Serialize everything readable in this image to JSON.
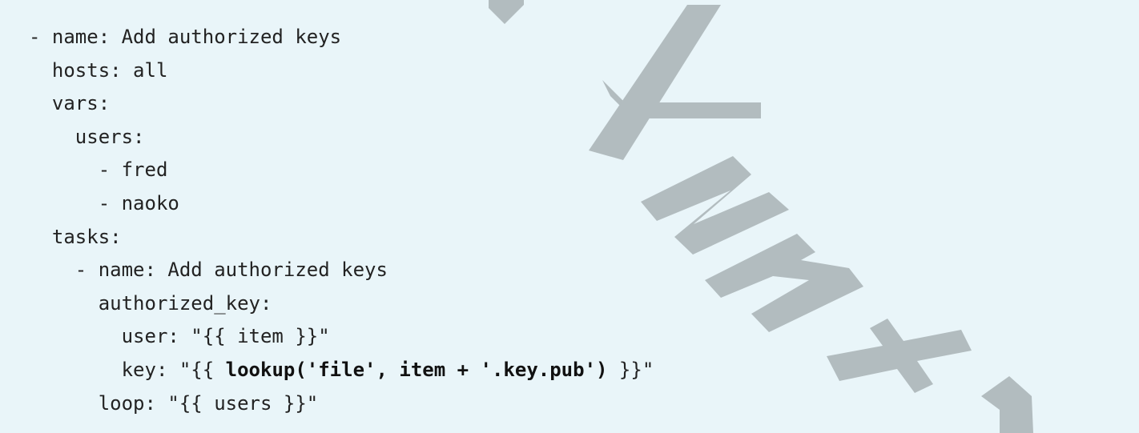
{
  "code": {
    "lines": [
      "- name: Add authorized keys",
      "  hosts: all",
      "  vars:",
      "    users:",
      "      - fred",
      "      - naoko",
      "  tasks:",
      "    - name: Add authorized keys",
      "      authorized_key:",
      "        user: \"{{ item }}\"",
      "        key: \"{{ ",
      "      loop: \"{{ users }}\""
    ],
    "key_line_bold": "lookup('file', item + '.key.pub')",
    "key_line_suffix": " }}\""
  },
  "watermark": {
    "text": "Yunx",
    "color": "#b2bcbf"
  }
}
